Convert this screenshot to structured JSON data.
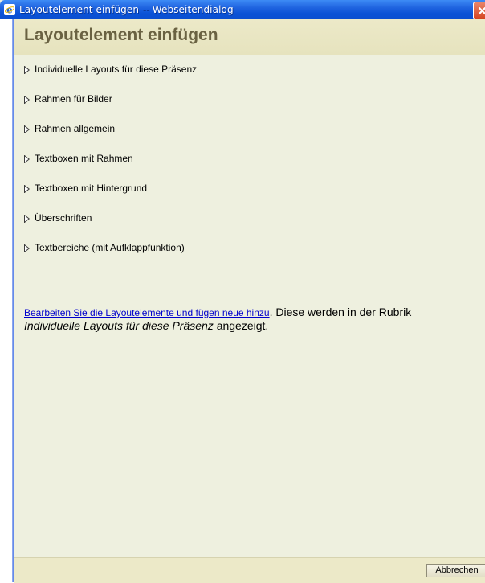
{
  "window": {
    "title": "Layoutelement einfügen -- Webseitendialog"
  },
  "dialog": {
    "heading": "Layoutelement einfügen",
    "items": [
      {
        "label": "Individuelle Layouts für diese Präsenz"
      },
      {
        "label": "Rahmen für Bilder"
      },
      {
        "label": "Rahmen allgemein"
      },
      {
        "label": "Textboxen mit Rahmen"
      },
      {
        "label": "Textboxen mit Hintergrund"
      },
      {
        "label": "Überschriften"
      },
      {
        "label": "Textbereiche (mit Aufklappfunktion)"
      }
    ],
    "info": {
      "link_text": "Bearbeiten Sie die Layoutelemente und fügen neue hinzu",
      "text_after_link": ". Diese werden in der Rubrik ",
      "rubric_name": "Individuelle Layouts für diese Präsenz",
      "text_end": " angezeigt."
    }
  },
  "footer": {
    "cancel_label": "Abbrechen"
  },
  "colors": {
    "titlebar_blue": "#0a52d6",
    "heading_color": "#6a6242",
    "background": "#eef0df",
    "link_color": "#0000cc"
  },
  "icons": {
    "window_icon": "internet-explorer-icon",
    "close": "close-icon",
    "expand": "triangle-right-icon"
  }
}
